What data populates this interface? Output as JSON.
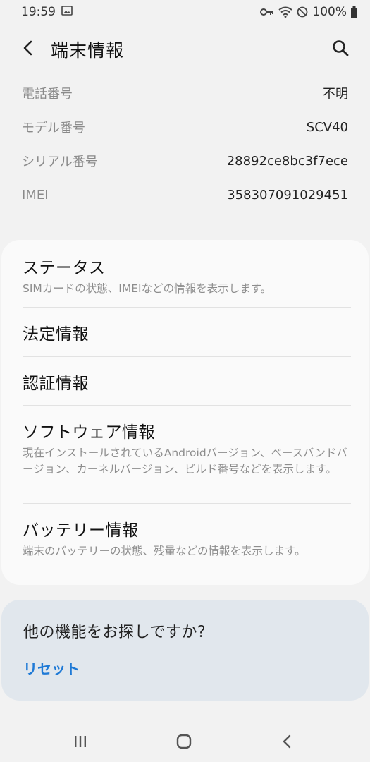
{
  "status_bar": {
    "time": "19:59",
    "battery": "100%",
    "icons": [
      "image-icon",
      "key-icon",
      "wifi-icon",
      "do-not-disturb-icon",
      "battery-icon"
    ]
  },
  "app_bar": {
    "title": "端末情報",
    "back_icon": "chevron-left-icon",
    "search_icon": "search-icon"
  },
  "info": [
    {
      "label": "電話番号",
      "value": "不明"
    },
    {
      "label": "モデル番号",
      "value": "SCV40"
    },
    {
      "label": "シリアル番号",
      "value": "28892ce8bc3f7ece"
    },
    {
      "label": "IMEI",
      "value": "358307091029451"
    }
  ],
  "menu": [
    {
      "title": "ステータス",
      "desc": "SIMカードの状態、IMEIなどの情報を表示します。"
    },
    {
      "title": "法定情報",
      "desc": ""
    },
    {
      "title": "認証情報",
      "desc": ""
    },
    {
      "title": "ソフトウェア情報",
      "desc": "現在インストールされているAndroidバージョン、ベースバンドバージョン、カーネルバージョン、ビルド番号などを表示します。"
    },
    {
      "title": "バッテリー情報",
      "desc": "端末のバッテリーの状態、残量などの情報を表示します。"
    }
  ],
  "suggestion": {
    "title": "他の機能をお探しですか？",
    "link": "リセット"
  },
  "colors": {
    "background": "#f2f2f2",
    "card": "#fafafa",
    "suggestion_card": "#e1e7ed",
    "link": "#1f7ad6"
  },
  "nav_bar": {
    "icons": [
      "recent-apps-icon",
      "home-icon",
      "back-icon"
    ]
  }
}
